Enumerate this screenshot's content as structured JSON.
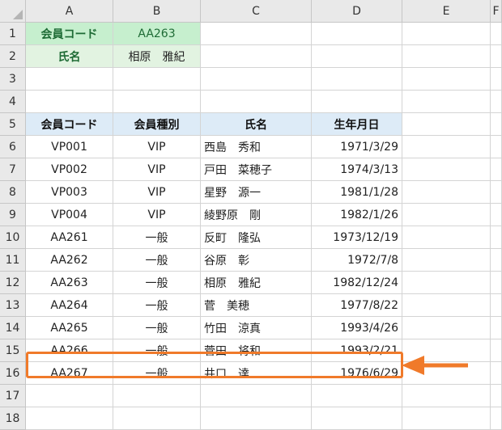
{
  "columns": [
    "A",
    "B",
    "C",
    "D",
    "E",
    "F"
  ],
  "rows": [
    "1",
    "2",
    "3",
    "4",
    "5",
    "6",
    "7",
    "8",
    "9",
    "10",
    "11",
    "12",
    "13",
    "14",
    "15",
    "16",
    "17",
    "18"
  ],
  "lookup": {
    "code_label": "会員コード",
    "code_value": "AA263",
    "name_label": "氏名",
    "name_value": "相原　雅紀"
  },
  "table": {
    "headers": [
      "会員コード",
      "会員種別",
      "氏名",
      "生年月日"
    ],
    "rows": [
      [
        "VP001",
        "VIP",
        "西島　秀和",
        "1971/3/29"
      ],
      [
        "VP002",
        "VIP",
        "戸田　菜穂子",
        "1974/3/13"
      ],
      [
        "VP003",
        "VIP",
        "星野　源一",
        "1981/1/28"
      ],
      [
        "VP004",
        "VIP",
        "綾野原　剛",
        "1982/1/26"
      ],
      [
        "AA261",
        "一般",
        "反町　隆弘",
        "1973/12/19"
      ],
      [
        "AA262",
        "一般",
        "谷原　彰",
        "1972/7/8"
      ],
      [
        "AA263",
        "一般",
        "相原　雅紀",
        "1982/12/24"
      ],
      [
        "AA264",
        "一般",
        "菅　美穂",
        "1977/8/22"
      ],
      [
        "AA265",
        "一般",
        "竹田　涼真",
        "1993/4/26"
      ],
      [
        "AA266",
        "一般",
        "菅田　将和",
        "1993/2/21"
      ],
      [
        "AA267",
        "一般",
        "井口　達",
        "1976/6/29"
      ]
    ]
  },
  "colors": {
    "accent_orange": "#f07a2a",
    "header_blue": "#ddebf7",
    "lookup_green": "#c6efce",
    "lookup_green_light": "#e2f3e1"
  }
}
